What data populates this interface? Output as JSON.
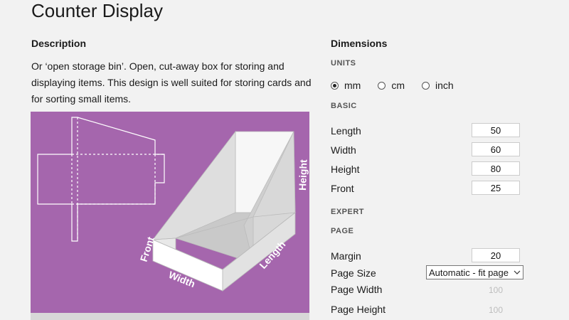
{
  "page": {
    "title": "Counter Display"
  },
  "description": {
    "heading": "Description",
    "text": "Or ‘open storage bin’. Open, cut-away box for storing and displaying items. This design is well suited for storing cards and for sorting small items."
  },
  "illustration": {
    "background": "#a566ad",
    "labels": {
      "front": "Front",
      "width": "Width",
      "length": "Length",
      "height": "Height"
    }
  },
  "dimensions": {
    "heading": "Dimensions",
    "units": {
      "heading": "UNITS",
      "options": [
        {
          "label": "mm",
          "selected": true
        },
        {
          "label": "cm",
          "selected": false
        },
        {
          "label": "inch",
          "selected": false
        }
      ]
    },
    "basic": {
      "heading": "BASIC",
      "fields": [
        {
          "label": "Length",
          "value": "50"
        },
        {
          "label": "Width",
          "value": "60"
        },
        {
          "label": "Height",
          "value": "80"
        },
        {
          "label": "Front",
          "value": "25"
        }
      ]
    },
    "expert": {
      "heading": "EXPERT"
    },
    "page": {
      "heading": "PAGE",
      "margin": {
        "label": "Margin",
        "value": "20"
      },
      "page_size": {
        "label": "Page Size",
        "value": "Automatic - fit page"
      },
      "page_width": {
        "label": "Page Width",
        "value": "100"
      },
      "page_height": {
        "label": "Page Height",
        "value": "100"
      }
    }
  }
}
